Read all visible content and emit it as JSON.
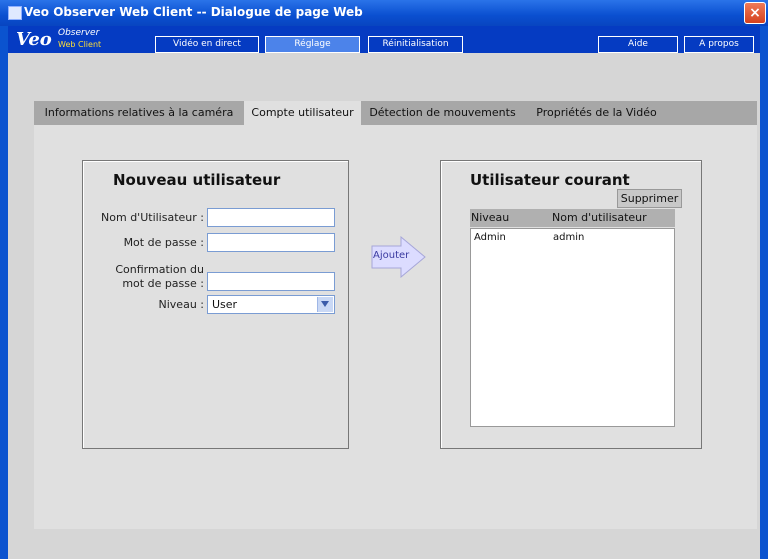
{
  "window": {
    "title": "Veo Observer Web Client -- Dialogue de page Web",
    "close_label": "×"
  },
  "logo": {
    "veo": "Veo",
    "observer": "Observer",
    "web_client": "Web Client"
  },
  "nav": {
    "live": "Vidéo en direct",
    "settings": "Réglage",
    "reset": "Réinitialisation",
    "help": "Aide",
    "about": "A propos"
  },
  "tabs": [
    "Informations relatives à la caméra",
    "Compte utilisateur",
    "Détection de mouvements",
    "Propriétés de la Vidéo"
  ],
  "new_user": {
    "title": "Nouveau utilisateur",
    "username_label": "Nom d'Utilisateur :",
    "password_label": "Mot de passe :",
    "confirm_label_1": "Confirmation du",
    "confirm_label_2": "mot de passe :",
    "level_label": "Niveau :",
    "level_value": "User"
  },
  "add_button": "Ajouter",
  "current_user": {
    "title": "Utilisateur courant",
    "delete_button": "Supprimer",
    "columns": [
      "Niveau",
      "Nom d'utilisateur"
    ],
    "rows": [
      {
        "level": "Admin",
        "name": "admin"
      }
    ]
  },
  "colors": {
    "title_bar": "#0a4fd0",
    "nav_bar": "#053bc2",
    "panel": "#e0e0e0",
    "tab_strip": "#a7a7a7"
  }
}
